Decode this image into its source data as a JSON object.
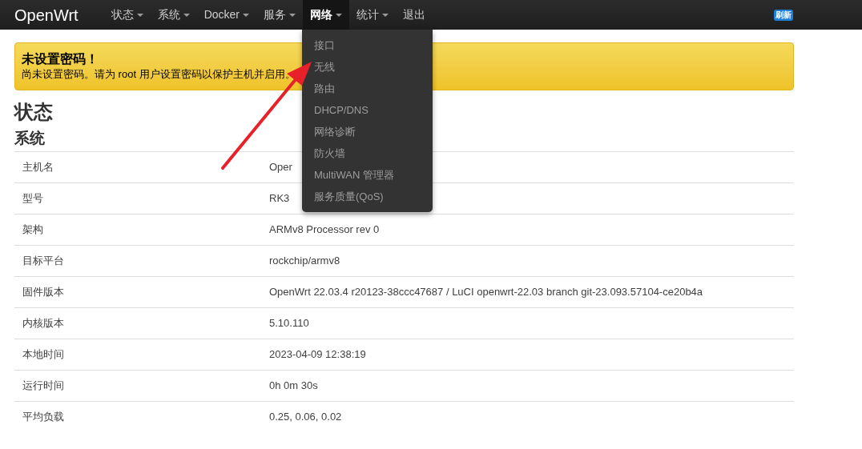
{
  "navbar": {
    "brand": "OpenWrt",
    "items": [
      {
        "label": "状态",
        "dropdown": true,
        "selected": false
      },
      {
        "label": "系统",
        "dropdown": true,
        "selected": false
      },
      {
        "label": "Docker",
        "dropdown": true,
        "selected": false
      },
      {
        "label": "服务",
        "dropdown": true,
        "selected": false
      },
      {
        "label": "网络",
        "dropdown": true,
        "selected": true
      },
      {
        "label": "统计",
        "dropdown": true,
        "selected": false
      },
      {
        "label": "退出",
        "dropdown": false,
        "selected": false
      }
    ],
    "badge": "刷新"
  },
  "dropdown_menu": {
    "items": [
      "接口",
      "无线",
      "路由",
      "DHCP/DNS",
      "网络诊断",
      "防火墙",
      "MultiWAN 管理器",
      "服务质量(QoS)"
    ]
  },
  "alert": {
    "title": "未设置密码！",
    "message": "尚未设置密码。请为 root 用户设置密码以保护主机并启用。"
  },
  "page_title": "状态",
  "section_title": "系统",
  "table": {
    "rows": [
      {
        "label": "主机名",
        "value": "Oper"
      },
      {
        "label": "型号",
        "value": "RK3"
      },
      {
        "label": "架构",
        "value": "ARMv8 Processor rev 0"
      },
      {
        "label": "目标平台",
        "value": "rockchip/armv8"
      },
      {
        "label": "固件版本",
        "value": "OpenWrt 22.03.4 r20123-38ccc47687 / LuCI openwrt-22.03 branch git-23.093.57104-ce20b4a"
      },
      {
        "label": "内核版本",
        "value": "5.10.110"
      },
      {
        "label": "本地时间",
        "value": "2023-04-09 12:38:19"
      },
      {
        "label": "运行时间",
        "value": "0h 0m 30s"
      },
      {
        "label": "平均负载",
        "value": "0.25, 0.06, 0.02"
      }
    ]
  }
}
